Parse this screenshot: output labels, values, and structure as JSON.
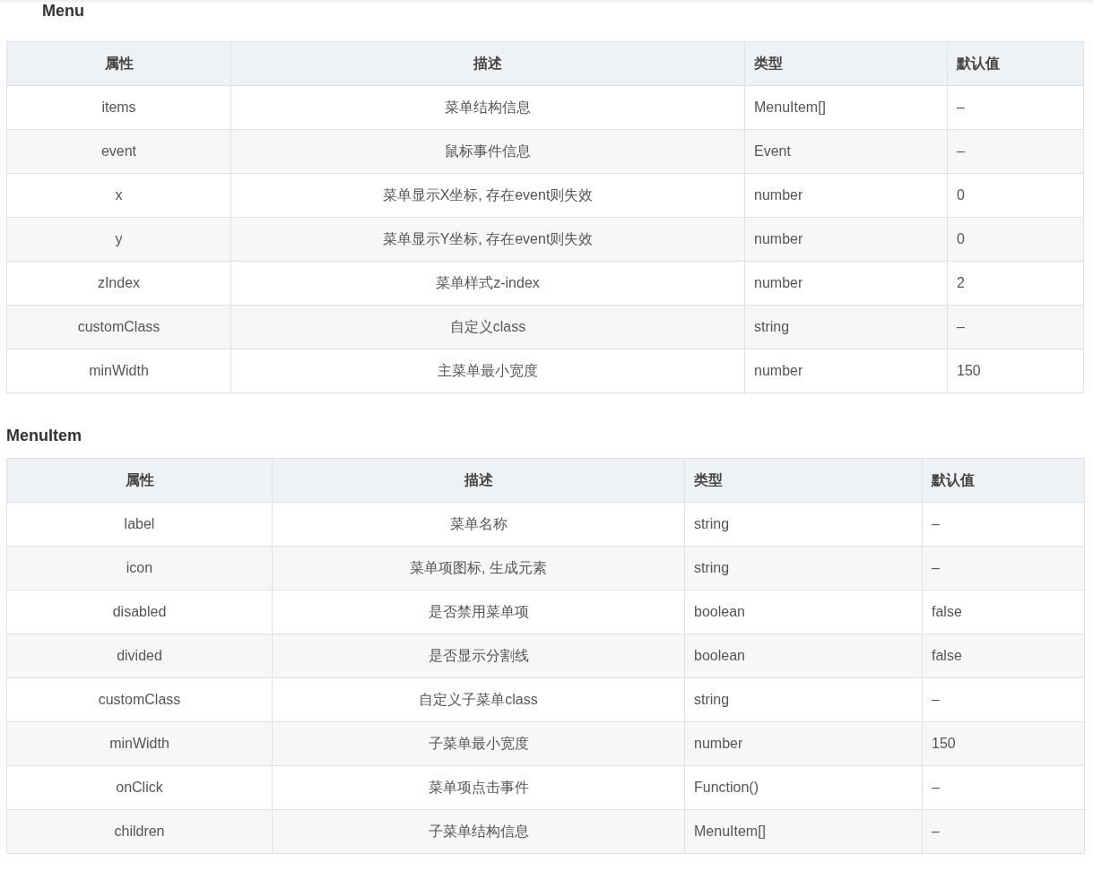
{
  "sections": [
    {
      "title": "Menu",
      "columns": [
        "属性",
        "描述",
        "类型",
        "默认值"
      ],
      "rows": [
        [
          "items",
          "菜单结构信息",
          "MenuItem[]",
          "–"
        ],
        [
          "event",
          "鼠标事件信息",
          "Event",
          "–"
        ],
        [
          "x",
          "菜单显示X坐标, 存在event则失效",
          "number",
          "0"
        ],
        [
          "y",
          "菜单显示Y坐标, 存在event则失效",
          "number",
          "0"
        ],
        [
          "zIndex",
          "菜单样式z-index",
          "number",
          "2"
        ],
        [
          "customClass",
          "自定义class",
          "string",
          "–"
        ],
        [
          "minWidth",
          "主菜单最小宽度",
          "number",
          "150"
        ]
      ]
    },
    {
      "title": "MenuItem",
      "columns": [
        "属性",
        "描述",
        "类型",
        "默认值"
      ],
      "rows": [
        [
          "label",
          "菜单名称",
          "string",
          "–"
        ],
        [
          "icon",
          "菜单项图标, 生成元素",
          "string",
          "–"
        ],
        [
          "disabled",
          "是否禁用菜单项",
          "boolean",
          "false"
        ],
        [
          "divided",
          "是否显示分割线",
          "boolean",
          "false"
        ],
        [
          "customClass",
          "自定义子菜单class",
          "string",
          "–"
        ],
        [
          "minWidth",
          "子菜单最小宽度",
          "number",
          "150"
        ],
        [
          "onClick",
          "菜单项点击事件",
          "Function()",
          "–"
        ],
        [
          "children",
          "子菜单结构信息",
          "MenuItem[]",
          "–"
        ]
      ]
    }
  ]
}
